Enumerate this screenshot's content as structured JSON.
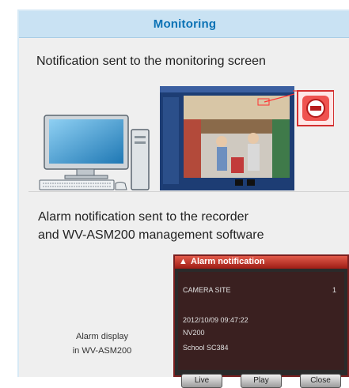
{
  "panel": {
    "title": "Monitoring",
    "section1": {
      "heading": "Notification sent to the monitoring screen"
    },
    "section2": {
      "heading_line1": "Alarm notification sent to the recorder",
      "heading_line2": "and WV-ASM200 management software",
      "caption_line1": "Alarm display",
      "caption_line2": "in WV-ASM200"
    },
    "alarm_window": {
      "title": "Alarm notification",
      "camera": "CAMERA SITE",
      "count": "1",
      "timestamp": "2012/10/09 09:47:22",
      "device": "NV200",
      "location": "School SC384",
      "buttons": [
        "Live",
        "Play",
        "Close"
      ]
    }
  },
  "colors": {
    "header_bg": "#c9e2f3",
    "title_text": "#0b72b5",
    "alarm_red": "#c0392b"
  }
}
